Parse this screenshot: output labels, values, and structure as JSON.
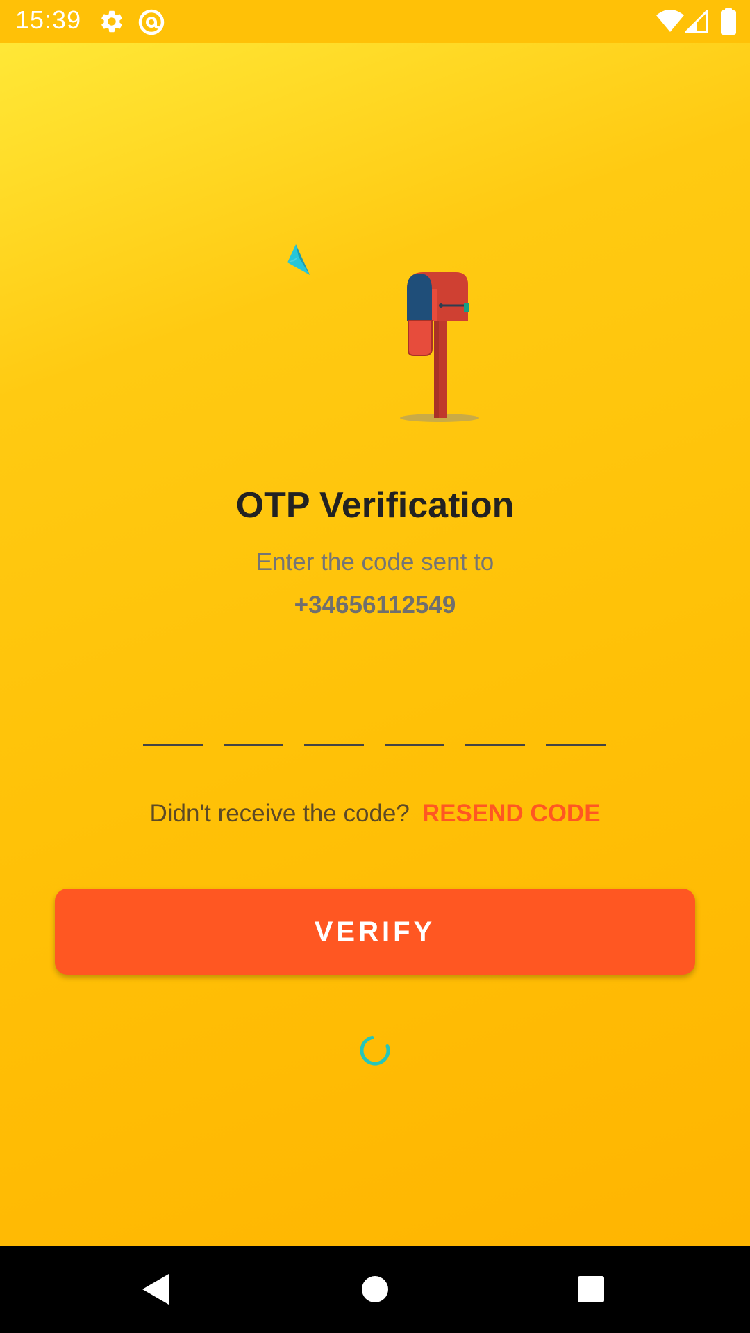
{
  "status_bar": {
    "time": "15:39",
    "icons_left": [
      "settings-icon",
      "at-sign-icon"
    ],
    "icons_right": [
      "wifi-icon",
      "cell-signal-icon",
      "battery-icon"
    ]
  },
  "illustration": {
    "icons": [
      "mailbox-icon",
      "paper-plane-icon"
    ]
  },
  "content": {
    "title": "OTP Verification",
    "subtitle": "Enter the code sent to",
    "phone": "+34656112549"
  },
  "otp": {
    "digits": [
      "",
      "",
      "",
      "",
      "",
      ""
    ]
  },
  "resend": {
    "prompt": "Didn't receive the code?",
    "link": "RESEND CODE"
  },
  "verify": {
    "label": "VERIFY"
  },
  "loading": {
    "icon": "loading-spinner-icon"
  },
  "nav_bar": {
    "icons": [
      "back-icon",
      "home-icon",
      "recents-icon"
    ]
  },
  "colors": {
    "background_top": "#FFEB3B",
    "background_bottom": "#FFB300",
    "accent": "#FF5722",
    "spinner": "#26C6BA"
  }
}
